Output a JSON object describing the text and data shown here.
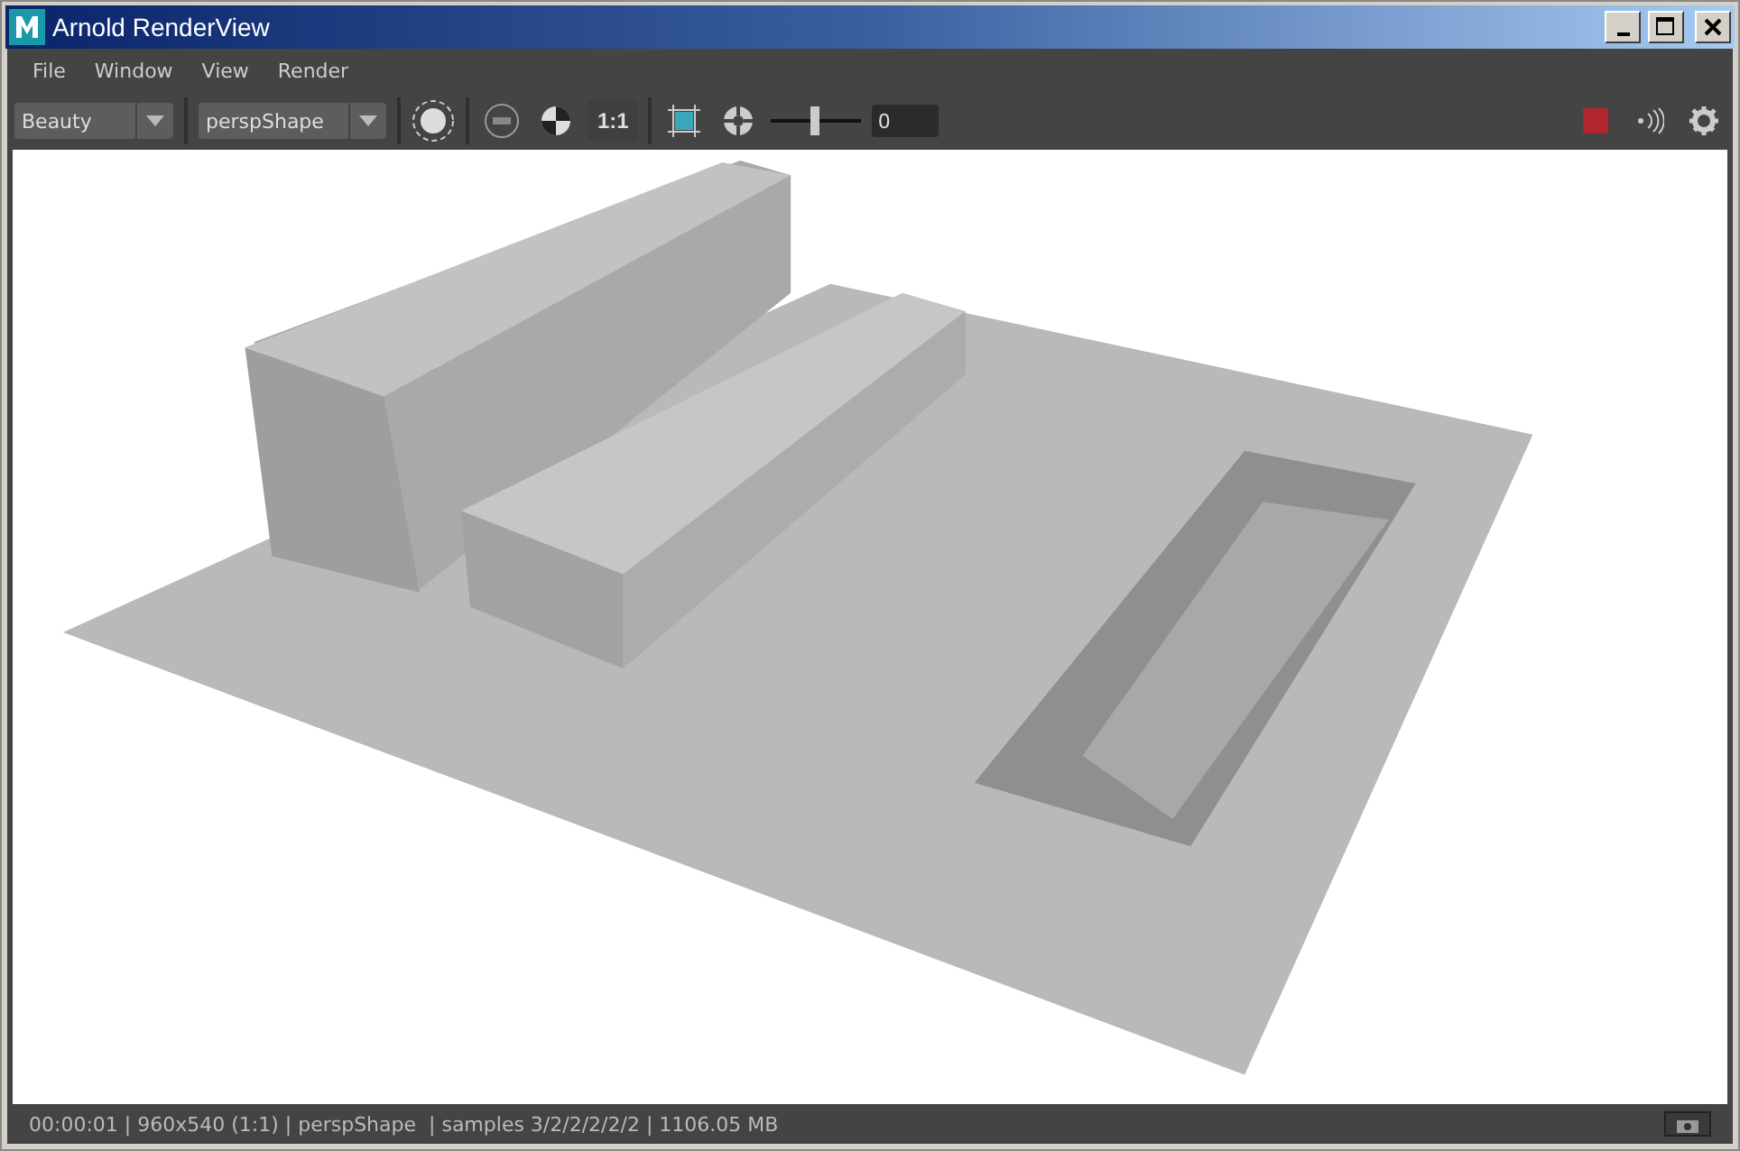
{
  "window": {
    "title": "Arnold RenderView"
  },
  "menu": [
    "File",
    "Window",
    "View",
    "Render"
  ],
  "toolbar": {
    "aov": "Beauty",
    "camera": "perspShape",
    "zoom": "1:1",
    "exposure": {
      "level": 0.48
    },
    "exposure_value": "0"
  },
  "status_bar": {
    "text": "00:00:01 | 960x540 (1:1) | perspShape  | samples 3/2/2/2/2/2 | 1106.05 MB"
  }
}
